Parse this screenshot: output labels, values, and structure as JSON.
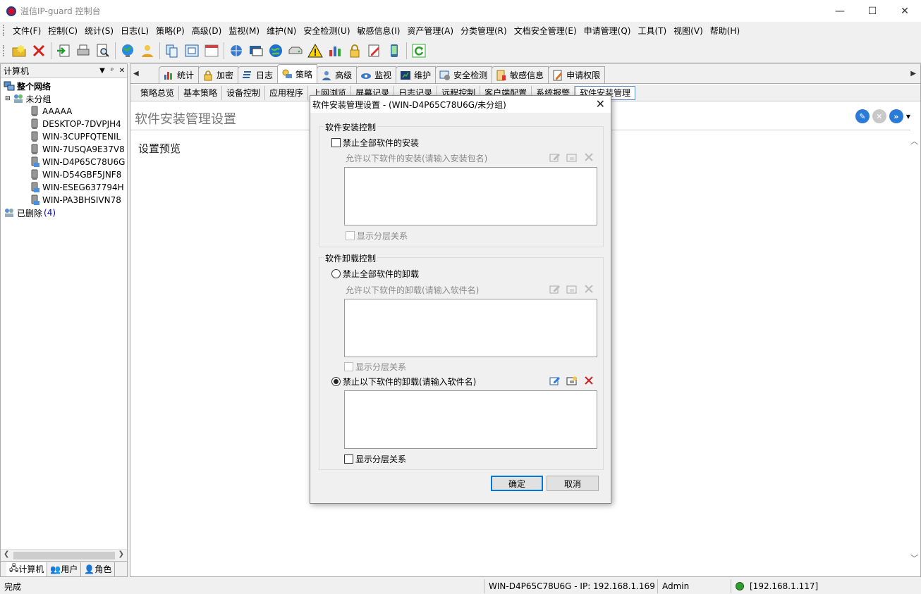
{
  "window": {
    "title": "溢信IP-guard 控制台",
    "controls": [
      "—",
      "☐",
      "✕"
    ]
  },
  "menu": [
    "文件(F)",
    "控制(C)",
    "统计(S)",
    "日志(L)",
    "策略(P)",
    "高级(D)",
    "监视(M)",
    "维护(N)",
    "安全检测(U)",
    "敏感信息(I)",
    "资产管理(A)",
    "分类管理(R)",
    "文档安全管理(E)",
    "申请管理(Q)",
    "工具(T)",
    "视图(V)",
    "帮助(H)"
  ],
  "left_panel": {
    "title": "计算机",
    "tree": {
      "root": "整个网络",
      "group": "未分组",
      "computers": [
        "AAAAA",
        "DESKTOP-7DVPJH4",
        "WIN-3CUPFQTENIL",
        "WIN-7USQA9E37V8",
        "WIN-D4P65C78U6G",
        "WIN-D54GBF5JNF8",
        "WIN-ESEG637794H",
        "WIN-PA3BHSIVN78"
      ],
      "deleted": "已删除",
      "deleted_count": "(4)"
    },
    "bottom_tabs": [
      "计算机",
      "用户",
      "角色"
    ]
  },
  "main_tabs": [
    "统计",
    "加密",
    "日志",
    "策略",
    "高级",
    "监视",
    "维护",
    "安全检测",
    "敏感信息",
    "申请权限"
  ],
  "sub_tabs": [
    "策略总览",
    "基本策略",
    "设备控制",
    "应用程序",
    "上网浏览",
    "屏幕记录",
    "日志记录",
    "远程控制",
    "客户端配置",
    "系统报警",
    "软件安装管理"
  ],
  "content": {
    "title": "软件安装管理设置",
    "preview_label": "设置预览"
  },
  "dialog": {
    "title": "软件安装管理设置 - (WIN-D4P65C78U6G/未分组)",
    "install_group": {
      "title": "软件安装控制",
      "forbid_all": "禁止全部软件的安装",
      "allow_hint": "允许以下软件的安装(请输入安装包名)",
      "show_hierarchy": "显示分层关系"
    },
    "uninstall_group": {
      "title": "软件卸载控制",
      "forbid_all": "禁止全部软件的卸载",
      "allow_hint": "允许以下软件的卸载(请输入软件名)",
      "show_hierarchy_1": "显示分层关系",
      "forbid_listed": "禁止以下软件的卸载(请输入软件名)",
      "show_hierarchy_2": "显示分层关系"
    },
    "ok": "确定",
    "cancel": "取消"
  },
  "status": {
    "ready": "完成",
    "host_ip": "WIN-D4P65C78U6G - IP: 192.168.1.169",
    "user": "Admin",
    "server": "[192.168.1.117]"
  },
  "colors": {
    "accent": "#0078d7",
    "tab_border": "#5f8fd0",
    "status_ok": "#2e9e2e"
  }
}
